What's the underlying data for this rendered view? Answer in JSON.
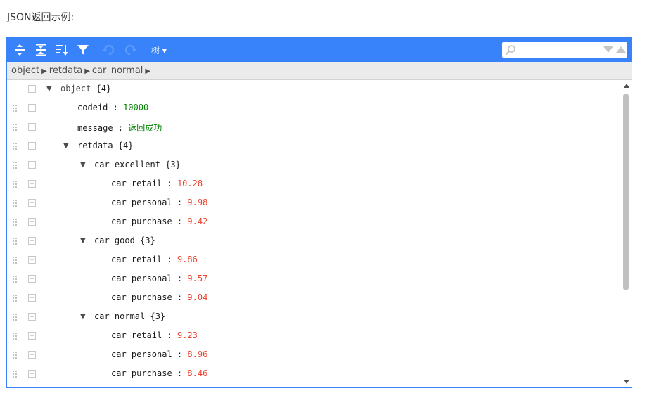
{
  "heading": "JSON返回示例:",
  "colors": {
    "accent": "#3883fa",
    "string": "#008000",
    "number": "#ee422e"
  },
  "menu": {
    "buttons": [
      {
        "name": "expand-all-button",
        "icon": "expand-all-icon"
      },
      {
        "name": "collapse-all-button",
        "icon": "collapse-all-icon"
      },
      {
        "name": "sort-button",
        "icon": "sort-icon"
      },
      {
        "name": "filter-button",
        "icon": "filter-icon"
      },
      {
        "name": "undo-button",
        "icon": "undo-icon"
      },
      {
        "name": "redo-button",
        "icon": "redo-icon"
      }
    ],
    "mode_label": "树 ▾",
    "search": {
      "value": "",
      "placeholder": ""
    }
  },
  "breadcrumb": [
    "object",
    "retdata",
    "car_normal"
  ],
  "rows": [
    {
      "depth": 0,
      "expandable": true,
      "key": "object",
      "count": "{4}",
      "root": true
    },
    {
      "depth": 1,
      "key": "codeid",
      "value": "10000",
      "type": "string"
    },
    {
      "depth": 1,
      "key": "message",
      "value": "返回成功",
      "type": "string"
    },
    {
      "depth": 1,
      "expandable": true,
      "key": "retdata",
      "count": "{4}"
    },
    {
      "depth": 2,
      "expandable": true,
      "key": "car_excellent",
      "count": "{3}"
    },
    {
      "depth": 3,
      "key": "car_retail",
      "value": "10.28",
      "type": "number"
    },
    {
      "depth": 3,
      "key": "car_personal",
      "value": "9.98",
      "type": "number"
    },
    {
      "depth": 3,
      "key": "car_purchase",
      "value": "9.42",
      "type": "number"
    },
    {
      "depth": 2,
      "expandable": true,
      "key": "car_good",
      "count": "{3}"
    },
    {
      "depth": 3,
      "key": "car_retail",
      "value": "9.86",
      "type": "number"
    },
    {
      "depth": 3,
      "key": "car_personal",
      "value": "9.57",
      "type": "number"
    },
    {
      "depth": 3,
      "key": "car_purchase",
      "value": "9.04",
      "type": "number"
    },
    {
      "depth": 2,
      "expandable": true,
      "key": "car_normal",
      "count": "{3}"
    },
    {
      "depth": 3,
      "key": "car_retail",
      "value": "9.23",
      "type": "number"
    },
    {
      "depth": 3,
      "key": "car_personal",
      "value": "8.96",
      "type": "number"
    },
    {
      "depth": 3,
      "key": "car_purchase",
      "value": "8.46",
      "type": "number"
    }
  ]
}
